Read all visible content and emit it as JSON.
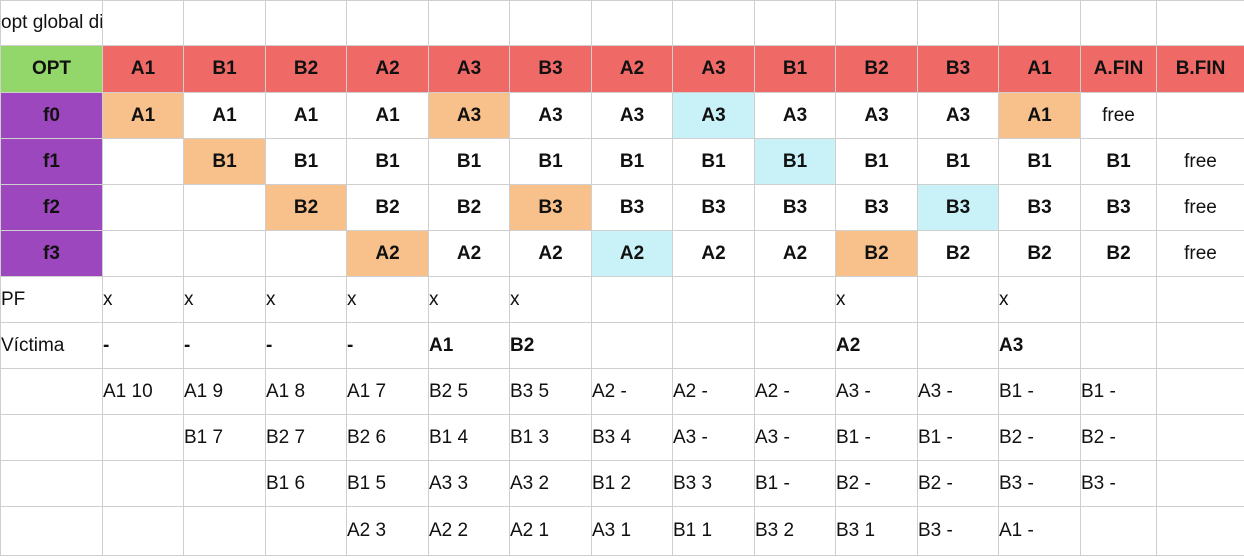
{
  "title": "opt global dinamico",
  "header": {
    "corner": "OPT",
    "columns": [
      "A1",
      "B1",
      "B2",
      "A2",
      "A3",
      "B3",
      "A2",
      "A3",
      "B1",
      "B2",
      "B3",
      "A1",
      "A.FIN",
      "B.FIN"
    ]
  },
  "frames": [
    {
      "label": "f0",
      "cells": [
        {
          "v": "A1",
          "h": "orange"
        },
        {
          "v": "A1",
          "h": ""
        },
        {
          "v": "A1",
          "h": ""
        },
        {
          "v": "A1",
          "h": ""
        },
        {
          "v": "A3",
          "h": "orange"
        },
        {
          "v": "A3",
          "h": ""
        },
        {
          "v": "A3",
          "h": ""
        },
        {
          "v": "A3",
          "h": "cyan"
        },
        {
          "v": "A3",
          "h": ""
        },
        {
          "v": "A3",
          "h": ""
        },
        {
          "v": "A3",
          "h": ""
        },
        {
          "v": "A1",
          "h": "orange"
        },
        {
          "v": "free",
          "h": "free"
        },
        {
          "v": "",
          "h": ""
        }
      ]
    },
    {
      "label": "f1",
      "cells": [
        {
          "v": "",
          "h": ""
        },
        {
          "v": "B1",
          "h": "orange"
        },
        {
          "v": "B1",
          "h": ""
        },
        {
          "v": "B1",
          "h": ""
        },
        {
          "v": "B1",
          "h": ""
        },
        {
          "v": "B1",
          "h": ""
        },
        {
          "v": "B1",
          "h": ""
        },
        {
          "v": "B1",
          "h": ""
        },
        {
          "v": "B1",
          "h": "cyan"
        },
        {
          "v": "B1",
          "h": ""
        },
        {
          "v": "B1",
          "h": ""
        },
        {
          "v": "B1",
          "h": ""
        },
        {
          "v": "B1",
          "h": ""
        },
        {
          "v": "free",
          "h": "free"
        }
      ]
    },
    {
      "label": "f2",
      "cells": [
        {
          "v": "",
          "h": ""
        },
        {
          "v": "",
          "h": ""
        },
        {
          "v": "B2",
          "h": "orange"
        },
        {
          "v": "B2",
          "h": ""
        },
        {
          "v": "B2",
          "h": ""
        },
        {
          "v": "B3",
          "h": "orange"
        },
        {
          "v": "B3",
          "h": ""
        },
        {
          "v": "B3",
          "h": ""
        },
        {
          "v": "B3",
          "h": ""
        },
        {
          "v": "B3",
          "h": ""
        },
        {
          "v": "B3",
          "h": "cyan"
        },
        {
          "v": "B3",
          "h": ""
        },
        {
          "v": "B3",
          "h": ""
        },
        {
          "v": "free",
          "h": "free"
        }
      ]
    },
    {
      "label": "f3",
      "cells": [
        {
          "v": "",
          "h": ""
        },
        {
          "v": "",
          "h": ""
        },
        {
          "v": "",
          "h": ""
        },
        {
          "v": "A2",
          "h": "orange"
        },
        {
          "v": "A2",
          "h": ""
        },
        {
          "v": "A2",
          "h": ""
        },
        {
          "v": "A2",
          "h": "cyan"
        },
        {
          "v": "A2",
          "h": ""
        },
        {
          "v": "A2",
          "h": ""
        },
        {
          "v": "B2",
          "h": "orange"
        },
        {
          "v": "B2",
          "h": ""
        },
        {
          "v": "B2",
          "h": ""
        },
        {
          "v": "B2",
          "h": ""
        },
        {
          "v": "free",
          "h": "free"
        }
      ]
    }
  ],
  "pf": {
    "label": "PF",
    "cells": [
      "x",
      "x",
      "x",
      "x",
      "x",
      "x",
      "",
      "",
      "",
      "x",
      "",
      "x",
      "",
      ""
    ]
  },
  "victima": {
    "label": "Víctima",
    "cells": [
      "-",
      "-",
      "-",
      "-",
      "A1",
      "B2",
      "",
      "",
      "",
      "A2",
      "",
      "A3",
      "",
      ""
    ]
  },
  "counters": [
    [
      "A1 10",
      "A1 9",
      "A1 8",
      "A1 7",
      "B2 5",
      "B3 5",
      "A2 -",
      "A2 -",
      "A2 -",
      "A3 -",
      "A3 -",
      "B1 -",
      "B1 -",
      ""
    ],
    [
      "",
      "B1 7",
      "B2 7",
      "B2 6",
      "B1 4",
      "B1 3",
      "B3 4",
      "A3 -",
      "A3 -",
      "B1 -",
      "B1 -",
      "B2 -",
      "B2 -",
      ""
    ],
    [
      "",
      "",
      "B1 6",
      "B1 5",
      "A3 3",
      "A3 2",
      "B1 2",
      "B3 3",
      "B1 -",
      "B2 -",
      "B2 -",
      "B3 -",
      "B3 -",
      ""
    ],
    [
      "",
      "",
      "",
      "A2 3",
      "A2 2",
      "A2 1",
      "A3 1",
      "B1 1",
      "B3 2",
      "B3 1",
      "B3 -",
      "A1 -",
      "",
      ""
    ]
  ]
}
